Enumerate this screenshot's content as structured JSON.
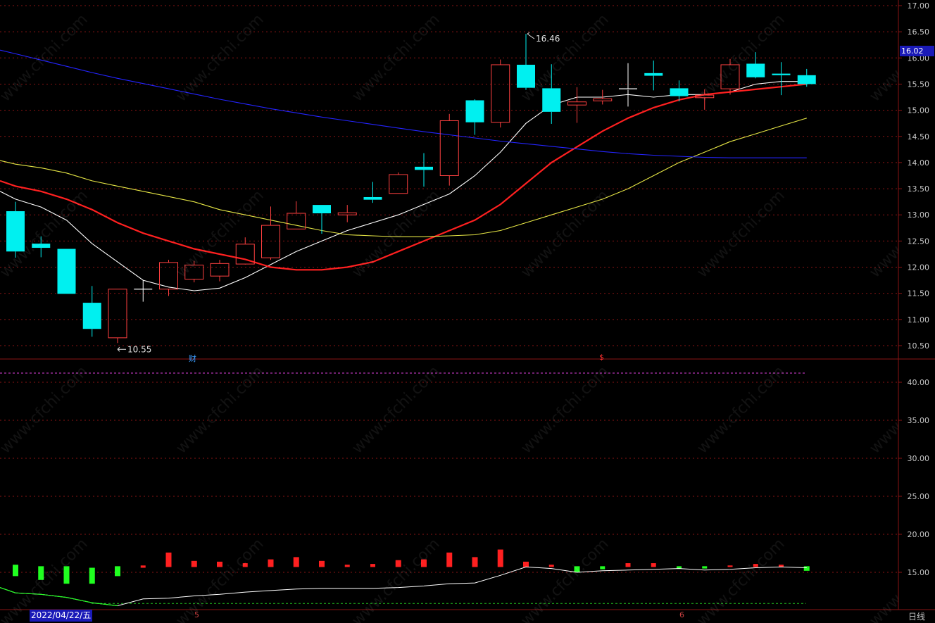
{
  "watermark": "www.cfchi.com",
  "price_tag": "16.02",
  "date_box": "2022/04/22/五",
  "period_type": "日线",
  "month_labels": [
    "5",
    "6"
  ],
  "event_markers": [
    {
      "label": "财",
      "color": "#3a9cff"
    },
    {
      "label": "$",
      "color": "#ff3030"
    }
  ],
  "annotations": {
    "high_label": "16.46",
    "low_label": "10.55"
  },
  "colors": {
    "up": "#ff4040",
    "down": "#00f0f0",
    "ma5": "#ffffff",
    "ma10": "#ff2020",
    "ma20": "#e6e645",
    "ma60": "#2424ff",
    "grid": "#8a1414",
    "dash_pink": "#e040e0",
    "dash_green": "#20c020",
    "vol_up": "#ff2020",
    "vol_down": "#20ff20"
  },
  "chart_data": [
    {
      "type": "candlestick",
      "title": "",
      "ylim": [
        10.3,
        17.05
      ],
      "yticks": [
        10.5,
        11.0,
        11.5,
        12.0,
        12.5,
        13.0,
        13.5,
        14.0,
        14.5,
        15.0,
        15.5,
        16.0,
        16.5,
        17.0
      ],
      "ytick_labels": [
        "10.50",
        "11.00",
        "11.50",
        "12.00",
        "12.50",
        "13.00",
        "13.50",
        "14.00",
        "14.50",
        "15.00",
        "15.50",
        "16.00",
        "16.50",
        "17.00"
      ],
      "candles": [
        {
          "o": 13.07,
          "h": 13.25,
          "l": 12.18,
          "c": 12.3
        },
        {
          "o": 12.45,
          "h": 12.59,
          "l": 12.19,
          "c": 12.37
        },
        {
          "o": 12.35,
          "h": 12.35,
          "l": 11.49,
          "c": 11.49
        },
        {
          "o": 11.32,
          "h": 11.64,
          "l": 10.67,
          "c": 10.82
        },
        {
          "o": 10.65,
          "h": 11.58,
          "l": 10.55,
          "c": 11.58
        },
        {
          "o": 11.58,
          "h": 11.75,
          "l": 11.34,
          "c": 11.58
        },
        {
          "o": 11.58,
          "h": 12.14,
          "l": 11.45,
          "c": 12.09
        },
        {
          "o": 11.77,
          "h": 12.12,
          "l": 11.71,
          "c": 12.04
        },
        {
          "o": 11.83,
          "h": 12.14,
          "l": 11.73,
          "c": 12.07
        },
        {
          "o": 12.06,
          "h": 12.57,
          "l": 12.05,
          "c": 12.44
        },
        {
          "o": 12.18,
          "h": 13.16,
          "l": 12.14,
          "c": 12.8
        },
        {
          "o": 12.73,
          "h": 13.26,
          "l": 12.73,
          "c": 13.03
        },
        {
          "o": 13.19,
          "h": 13.19,
          "l": 12.64,
          "c": 13.03
        },
        {
          "o": 13.0,
          "h": 13.19,
          "l": 12.86,
          "c": 13.04
        },
        {
          "o": 13.34,
          "h": 13.63,
          "l": 13.23,
          "c": 13.29
        },
        {
          "o": 13.41,
          "h": 13.81,
          "l": 13.41,
          "c": 13.77
        },
        {
          "o": 13.92,
          "h": 14.18,
          "l": 13.54,
          "c": 13.86
        },
        {
          "o": 13.75,
          "h": 14.93,
          "l": 13.56,
          "c": 14.8
        },
        {
          "o": 15.19,
          "h": 15.21,
          "l": 14.53,
          "c": 14.77
        },
        {
          "o": 14.77,
          "h": 15.97,
          "l": 14.67,
          "c": 15.87
        },
        {
          "o": 15.87,
          "h": 16.46,
          "l": 15.39,
          "c": 15.43
        },
        {
          "o": 15.42,
          "h": 15.88,
          "l": 14.74,
          "c": 14.97
        },
        {
          "o": 15.1,
          "h": 15.44,
          "l": 14.76,
          "c": 15.16
        },
        {
          "o": 15.18,
          "h": 15.39,
          "l": 15.11,
          "c": 15.22
        },
        {
          "o": 15.41,
          "h": 15.9,
          "l": 15.07,
          "c": 15.39
        },
        {
          "o": 15.71,
          "h": 15.95,
          "l": 15.38,
          "c": 15.66
        },
        {
          "o": 15.42,
          "h": 15.57,
          "l": 15.17,
          "c": 15.27
        },
        {
          "o": 15.24,
          "h": 15.4,
          "l": 15.01,
          "c": 15.29
        },
        {
          "o": 15.41,
          "h": 15.98,
          "l": 15.3,
          "c": 15.87
        },
        {
          "o": 15.89,
          "h": 16.11,
          "l": 15.61,
          "c": 15.63
        },
        {
          "o": 15.7,
          "h": 15.92,
          "l": 15.29,
          "c": 15.67
        },
        {
          "o": 15.67,
          "h": 15.79,
          "l": 15.45,
          "c": 15.5
        }
      ],
      "ma": [
        {
          "name": "MA5",
          "color": "#ffffff",
          "values": [
            13.3,
            13.15,
            12.9,
            12.45,
            12.1,
            11.75,
            11.62,
            11.55,
            11.6,
            11.8,
            12.05,
            12.3,
            12.5,
            12.7,
            12.85,
            13.0,
            13.2,
            13.4,
            13.75,
            14.2,
            14.75,
            15.1,
            15.25,
            15.25,
            15.3,
            15.25,
            15.3,
            15.3,
            15.35,
            15.5,
            15.55,
            15.55
          ]
        },
        {
          "name": "MA10",
          "color": "#ff2020",
          "values": [
            13.55,
            13.45,
            13.3,
            13.1,
            12.85,
            12.65,
            12.5,
            12.35,
            12.25,
            12.15,
            12.0,
            11.95,
            11.95,
            12.0,
            12.1,
            12.3,
            12.5,
            12.7,
            12.9,
            13.2,
            13.6,
            14.0,
            14.3,
            14.6,
            14.85,
            15.05,
            15.2,
            15.3,
            15.35,
            15.4,
            15.45,
            15.5
          ]
        },
        {
          "name": "MA20",
          "color": "#e6e645",
          "values": [
            13.97,
            13.9,
            13.8,
            13.65,
            13.55,
            13.45,
            13.35,
            13.25,
            13.1,
            13.0,
            12.9,
            12.8,
            12.7,
            12.62,
            12.6,
            12.58,
            12.58,
            12.6,
            12.62,
            12.7,
            12.85,
            13.0,
            13.15,
            13.3,
            13.5,
            13.75,
            14.0,
            14.2,
            14.4,
            14.55,
            14.7,
            14.85
          ]
        },
        {
          "name": "MA60",
          "color": "#2424ff",
          "values": [
            16.08,
            15.96,
            15.84,
            15.72,
            15.61,
            15.51,
            15.41,
            15.31,
            15.21,
            15.12,
            15.03,
            14.95,
            14.87,
            14.8,
            14.73,
            14.66,
            14.59,
            14.53,
            14.47,
            14.41,
            14.36,
            14.31,
            14.26,
            14.21,
            14.17,
            14.14,
            14.12,
            14.1,
            14.09,
            14.09,
            14.09,
            14.09
          ]
        }
      ]
    },
    {
      "type": "bar",
      "title": "",
      "ylim": [
        12.0,
        43.0
      ],
      "yticks": [
        15.0,
        20.0,
        25.0,
        30.0,
        35.0,
        40.0
      ],
      "ytick_labels": [
        "15.00",
        "20.00",
        "25.00",
        "30.00",
        "35.00",
        "40.00"
      ],
      "bars": [
        {
          "b": 14.5,
          "t": 16.0,
          "dir": "down"
        },
        {
          "b": 14.0,
          "t": 15.8,
          "dir": "down"
        },
        {
          "b": 13.5,
          "t": 15.8,
          "dir": "down"
        },
        {
          "b": 13.5,
          "t": 15.6,
          "dir": "down"
        },
        {
          "b": 14.5,
          "t": 15.8,
          "dir": "down"
        },
        {
          "b": 15.6,
          "t": 15.9,
          "dir": "up"
        },
        {
          "b": 15.7,
          "t": 17.6,
          "dir": "up"
        },
        {
          "b": 15.7,
          "t": 16.5,
          "dir": "up"
        },
        {
          "b": 15.7,
          "t": 16.4,
          "dir": "up"
        },
        {
          "b": 15.7,
          "t": 16.2,
          "dir": "up"
        },
        {
          "b": 15.7,
          "t": 16.7,
          "dir": "up"
        },
        {
          "b": 15.7,
          "t": 17.0,
          "dir": "up"
        },
        {
          "b": 15.7,
          "t": 16.5,
          "dir": "up"
        },
        {
          "b": 15.7,
          "t": 16.0,
          "dir": "up"
        },
        {
          "b": 15.7,
          "t": 16.1,
          "dir": "up"
        },
        {
          "b": 15.7,
          "t": 16.6,
          "dir": "up"
        },
        {
          "b": 15.7,
          "t": 16.7,
          "dir": "up"
        },
        {
          "b": 15.7,
          "t": 17.6,
          "dir": "up"
        },
        {
          "b": 15.7,
          "t": 17.0,
          "dir": "up"
        },
        {
          "b": 15.7,
          "t": 18.0,
          "dir": "up"
        },
        {
          "b": 15.7,
          "t": 16.4,
          "dir": "up"
        },
        {
          "b": 15.7,
          "t": 16.0,
          "dir": "up"
        },
        {
          "b": 15.0,
          "t": 15.8,
          "dir": "down"
        },
        {
          "b": 15.4,
          "t": 15.8,
          "dir": "down"
        },
        {
          "b": 15.7,
          "t": 16.2,
          "dir": "up"
        },
        {
          "b": 15.7,
          "t": 16.2,
          "dir": "up"
        },
        {
          "b": 15.5,
          "t": 15.8,
          "dir": "down"
        },
        {
          "b": 15.5,
          "t": 15.8,
          "dir": "down"
        },
        {
          "b": 15.7,
          "t": 15.9,
          "dir": "up"
        },
        {
          "b": 15.7,
          "t": 16.1,
          "dir": "up"
        },
        {
          "b": 15.7,
          "t": 16.0,
          "dir": "up"
        },
        {
          "b": 15.2,
          "t": 15.8,
          "dir": "down"
        }
      ],
      "line": [
        12.3,
        12.1,
        11.7,
        11.0,
        10.6,
        11.5,
        11.6,
        11.9,
        12.1,
        12.4,
        12.6,
        12.8,
        12.9,
        12.9,
        12.9,
        13.0,
        13.2,
        13.5,
        13.6,
        14.6,
        15.7,
        15.5,
        15.0,
        15.2,
        15.3,
        15.4,
        15.5,
        15.3,
        15.4,
        15.6,
        15.7,
        15.6
      ],
      "ref_levels": {
        "upper": 41.2,
        "lower": 10.9
      }
    }
  ]
}
